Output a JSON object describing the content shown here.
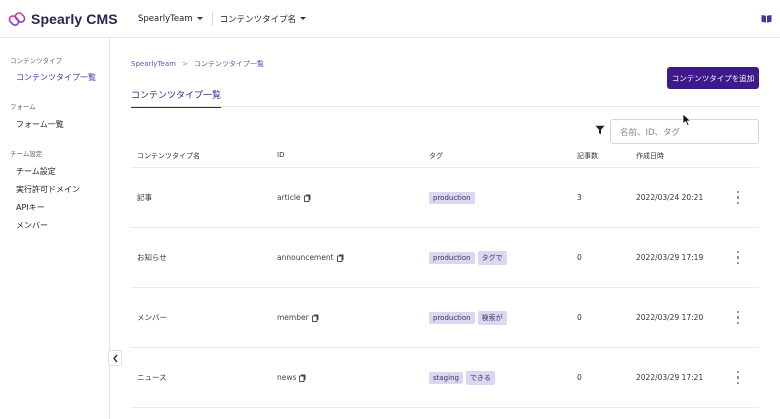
{
  "header": {
    "app_name": "Spearly CMS",
    "team_selector": "SpearlyTeam",
    "type_selector": "コンテンツタイプ名"
  },
  "sidebar": {
    "groups": [
      {
        "title": "コンテンツタイプ",
        "items": [
          {
            "label": "コンテンツタイプ一覧",
            "active": true
          }
        ]
      },
      {
        "title": "フォーム",
        "items": [
          {
            "label": "フォーム一覧",
            "active": false
          }
        ]
      },
      {
        "title": "チーム設定",
        "items": [
          {
            "label": "チーム設定",
            "active": false
          },
          {
            "label": "実行許可ドメイン",
            "active": false
          },
          {
            "label": "APIキー",
            "active": false
          },
          {
            "label": "メンバー",
            "active": false
          }
        ]
      }
    ]
  },
  "breadcrumb": {
    "root": "SpearlyTeam",
    "separator": ">",
    "current": "コンテンツタイプ一覧"
  },
  "page": {
    "tab_label": "コンテンツタイプ一覧",
    "add_button_label": "コンテンツタイプを追加",
    "search_placeholder": "名前、ID、タグ"
  },
  "table": {
    "columns": [
      "コンテンツタイプ名",
      "ID",
      "タグ",
      "記事数",
      "作成日時"
    ],
    "rows": [
      {
        "name": "記事",
        "id": "article",
        "tags": [
          "production"
        ],
        "count": "3",
        "created": "2022/03/24 20:21"
      },
      {
        "name": "お知らせ",
        "id": "announcement",
        "tags": [
          "production",
          "タグで"
        ],
        "count": "0",
        "created": "2022/03/29 17:19"
      },
      {
        "name": "メンバー",
        "id": "member",
        "tags": [
          "production",
          "検索が"
        ],
        "count": "0",
        "created": "2022/03/29 17:20"
      },
      {
        "name": "ニュース",
        "id": "news",
        "tags": [
          "staging",
          "できる"
        ],
        "count": "0",
        "created": "2022/03/29 17:21"
      }
    ]
  },
  "colors": {
    "accent": "#3d1a8a",
    "tag_bg": "#ddd6f2",
    "link": "#6b4fc8"
  },
  "icons": [
    "spearly-logo-icon",
    "chevron-down-icon",
    "book-icon",
    "filter-icon",
    "copy-icon",
    "more-vertical-icon",
    "chevron-left-icon",
    "cursor-icon"
  ]
}
